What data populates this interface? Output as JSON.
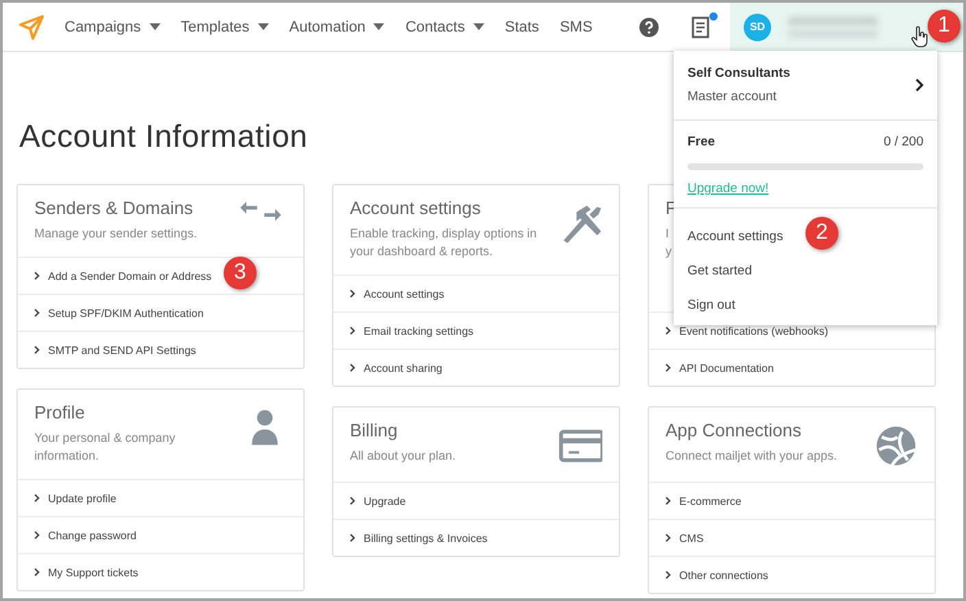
{
  "nav": {
    "items": [
      {
        "label": "Campaigns",
        "dropdown": true
      },
      {
        "label": "Templates",
        "dropdown": true
      },
      {
        "label": "Automation",
        "dropdown": true
      },
      {
        "label": "Contacts",
        "dropdown": true
      },
      {
        "label": "Stats",
        "dropdown": false
      },
      {
        "label": "SMS",
        "dropdown": false
      }
    ],
    "unread": true
  },
  "account": {
    "initials": "SD",
    "expanded": true
  },
  "menu": {
    "org": "Self Consultants",
    "role": "Master account",
    "plan": "Free",
    "usage": "0 / 200",
    "level": 0,
    "upgrade": "Upgrade now!",
    "items": [
      "Account settings",
      "Get started",
      "Sign out"
    ]
  },
  "page_title": "Account Information",
  "columns": [
    [
      {
        "title": "Senders & Domains",
        "description": "Manage your sender settings.",
        "links": [
          "Add a Sender Domain or Address",
          "Setup SPF/DKIM Authentication",
          "SMTP and SEND API Settings"
        ]
      },
      {
        "title": "Profile",
        "description": "Your personal & company information.",
        "links": [
          "Update profile",
          "Change password",
          "My Support tickets"
        ]
      }
    ],
    [
      {
        "title": "Account settings",
        "description": "Enable tracking, display options in your dashboard & reports.",
        "links": [
          "Account settings",
          "Email tracking settings",
          "Account sharing"
        ]
      },
      {
        "title": "Billing",
        "description": "All about your plan.",
        "links": [
          "Upgrade",
          "Billing settings & Invoices"
        ]
      }
    ],
    [
      {
        "title": "F",
        "description": "I\ny",
        "covered": true,
        "links": [
          "Event notifications (webhooks)",
          "API Documentation"
        ]
      },
      {
        "title": "App Connections",
        "description": "Connect mailjet with your apps.",
        "links": [
          "E-commerce",
          "CMS",
          "Other connections"
        ]
      }
    ]
  ],
  "callouts": [
    "1",
    "2",
    "3"
  ]
}
